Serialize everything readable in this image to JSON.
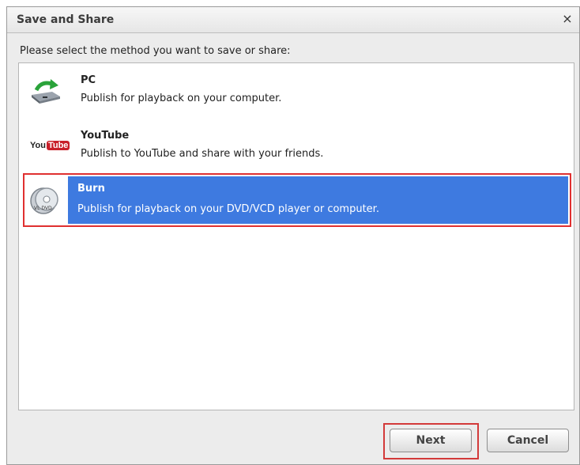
{
  "dialog": {
    "title": "Save and Share",
    "close_label": "×"
  },
  "prompt": "Please select the method you want to save or share:",
  "options": [
    {
      "name": "PC",
      "description": "Publish for playback on your computer.",
      "icon": "pc-publish-icon",
      "selected": false
    },
    {
      "name": "YouTube",
      "description": "Publish to YouTube and share with your friends.",
      "icon": "youtube-icon",
      "selected": false
    },
    {
      "name": "Burn",
      "description": "Publish for playback on your DVD/VCD player or computer.",
      "icon": "disc-burn-icon",
      "selected": true
    }
  ],
  "youtube_logo": {
    "you": "You",
    "tube": "Tube"
  },
  "burn_icon_text": "VL DVD",
  "buttons": {
    "next": "Next",
    "cancel": "Cancel"
  },
  "colors": {
    "selection": "#3e7ae0",
    "highlight_frame": "#e03030",
    "youtube_red": "#c8202a"
  }
}
